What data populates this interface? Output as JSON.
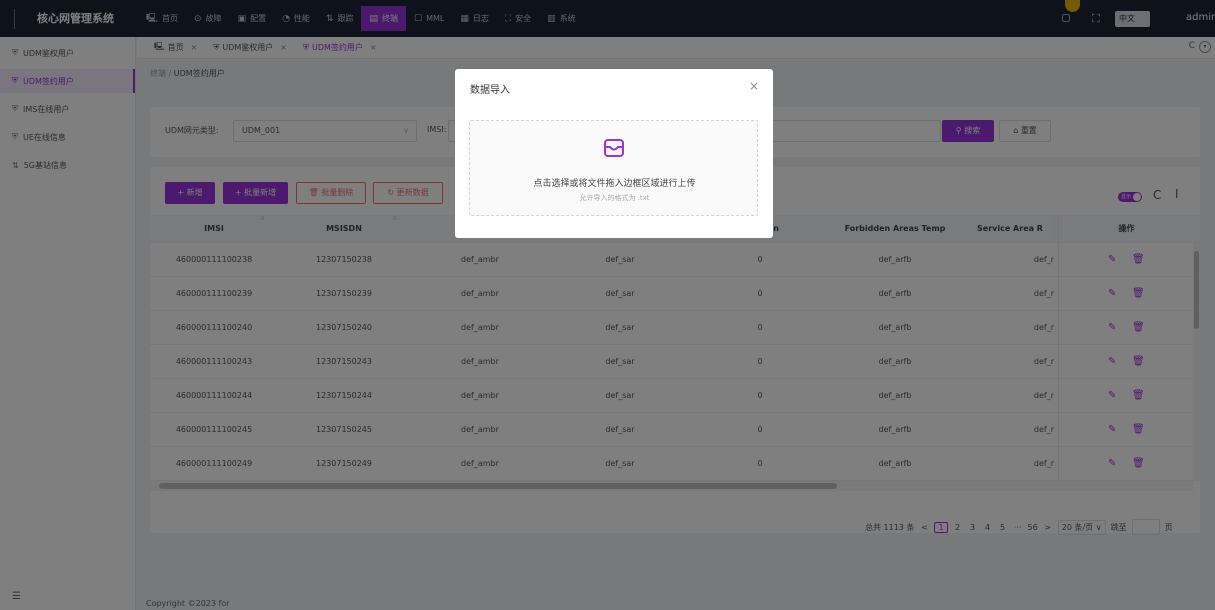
{
  "app": {
    "title": "核心网管理系统"
  },
  "top_menu": [
    {
      "label": "首页",
      "icon": "home-icon",
      "glyph": "🖳"
    },
    {
      "label": "故障",
      "icon": "alarm-icon",
      "glyph": "⊙"
    },
    {
      "label": "配置",
      "icon": "config-icon",
      "glyph": "▣"
    },
    {
      "label": "性能",
      "icon": "performance-icon",
      "glyph": "◔"
    },
    {
      "label": "跟踪",
      "icon": "trace-icon",
      "glyph": "⇅"
    },
    {
      "label": "终端",
      "icon": "terminal-icon",
      "glyph": "▤",
      "active": true
    },
    {
      "label": "MML",
      "icon": "mml-icon",
      "glyph": "☐"
    },
    {
      "label": "日志",
      "icon": "log-icon",
      "glyph": "▦"
    },
    {
      "label": "安全",
      "icon": "security-icon",
      "glyph": "⛶"
    },
    {
      "label": "系统",
      "icon": "system-icon",
      "glyph": "▥"
    }
  ],
  "header": {
    "language": "中文",
    "user": "admin"
  },
  "sidebar": {
    "items": [
      {
        "label": "UDM鉴权用户",
        "icon": "user-auth-icon",
        "glyph": "⛨"
      },
      {
        "label": "UDM签约用户",
        "icon": "user-sub-icon",
        "glyph": "⛨",
        "active": true
      },
      {
        "label": "IMS在线用户",
        "icon": "ims-user-icon",
        "glyph": "⛨"
      },
      {
        "label": "UE在线信息",
        "icon": "ue-icon",
        "glyph": "⛨"
      },
      {
        "label": "5G基站信息",
        "icon": "gnb-icon",
        "glyph": "⇅"
      }
    ]
  },
  "tabs": [
    {
      "label": "首页",
      "icon": "home-icon",
      "glyph": "🖳"
    },
    {
      "label": "UDM鉴权用户",
      "icon": "user-auth-icon",
      "glyph": "⛨"
    },
    {
      "label": "UDM签约用户",
      "icon": "user-sub-icon",
      "glyph": "⛨",
      "active": true
    }
  ],
  "breadcrumb": {
    "parent": "终端",
    "sep": " / ",
    "current": "UDM签约用户"
  },
  "filter": {
    "type_label": "UDM网元类型:",
    "type_value": "UDM_001",
    "imsi_label": "IMSI:",
    "search_label": "搜索",
    "reset_label": "重置"
  },
  "toolbar": {
    "add_label": "+ 新增",
    "batch_add_label": "+ 批量新增",
    "batch_delete_label": "批量删除",
    "update_label": "更新数据",
    "toggle_label": "显示"
  },
  "table": {
    "columns": [
      "IMSI",
      "MSISDN",
      "",
      "",
      "striction",
      "Forbidden Areas Temp",
      "Service Area R",
      "操作"
    ],
    "rows": [
      [
        "460000111100238",
        "12307150238",
        "def_ambr",
        "def_sar",
        "0",
        "def_arfb",
        "def_r"
      ],
      [
        "460000111100239",
        "12307150239",
        "def_ambr",
        "def_sar",
        "0",
        "def_arfb",
        "def_r"
      ],
      [
        "460000111100240",
        "12307150240",
        "def_ambr",
        "def_sar",
        "0",
        "def_arfb",
        "def_r"
      ],
      [
        "460000111100243",
        "12307150243",
        "def_ambr",
        "def_sar",
        "0",
        "def_arfb",
        "def_r"
      ],
      [
        "460000111100244",
        "12307150244",
        "def_ambr",
        "def_sar",
        "0",
        "def_arfb",
        "def_r"
      ],
      [
        "460000111100245",
        "12307150245",
        "def_ambr",
        "def_sar",
        "0",
        "def_arfb",
        "def_r"
      ],
      [
        "460000111100249",
        "12307150249",
        "def_ambr",
        "def_sar",
        "0",
        "def_arfb",
        "def_r"
      ]
    ]
  },
  "pagination": {
    "total": "总共 1113 条",
    "prev": "<",
    "pages": [
      "1",
      "2",
      "3",
      "4",
      "5",
      "···",
      "56"
    ],
    "current": "1",
    "next": ">",
    "page_size": "20 条/页",
    "goto_label": "跳至",
    "page_unit": "页"
  },
  "footer": {
    "text": "Copyright ©2023 for"
  },
  "modal": {
    "title": "数据导入",
    "close": "×",
    "upload_text": "点击选择或将文件拖入边框区域进行上传",
    "upload_hint": "允许导入的格式为 .txt"
  },
  "colors": {
    "accent": "#9933dd",
    "topbar": "#1c2536",
    "danger": "#f56c6c"
  }
}
